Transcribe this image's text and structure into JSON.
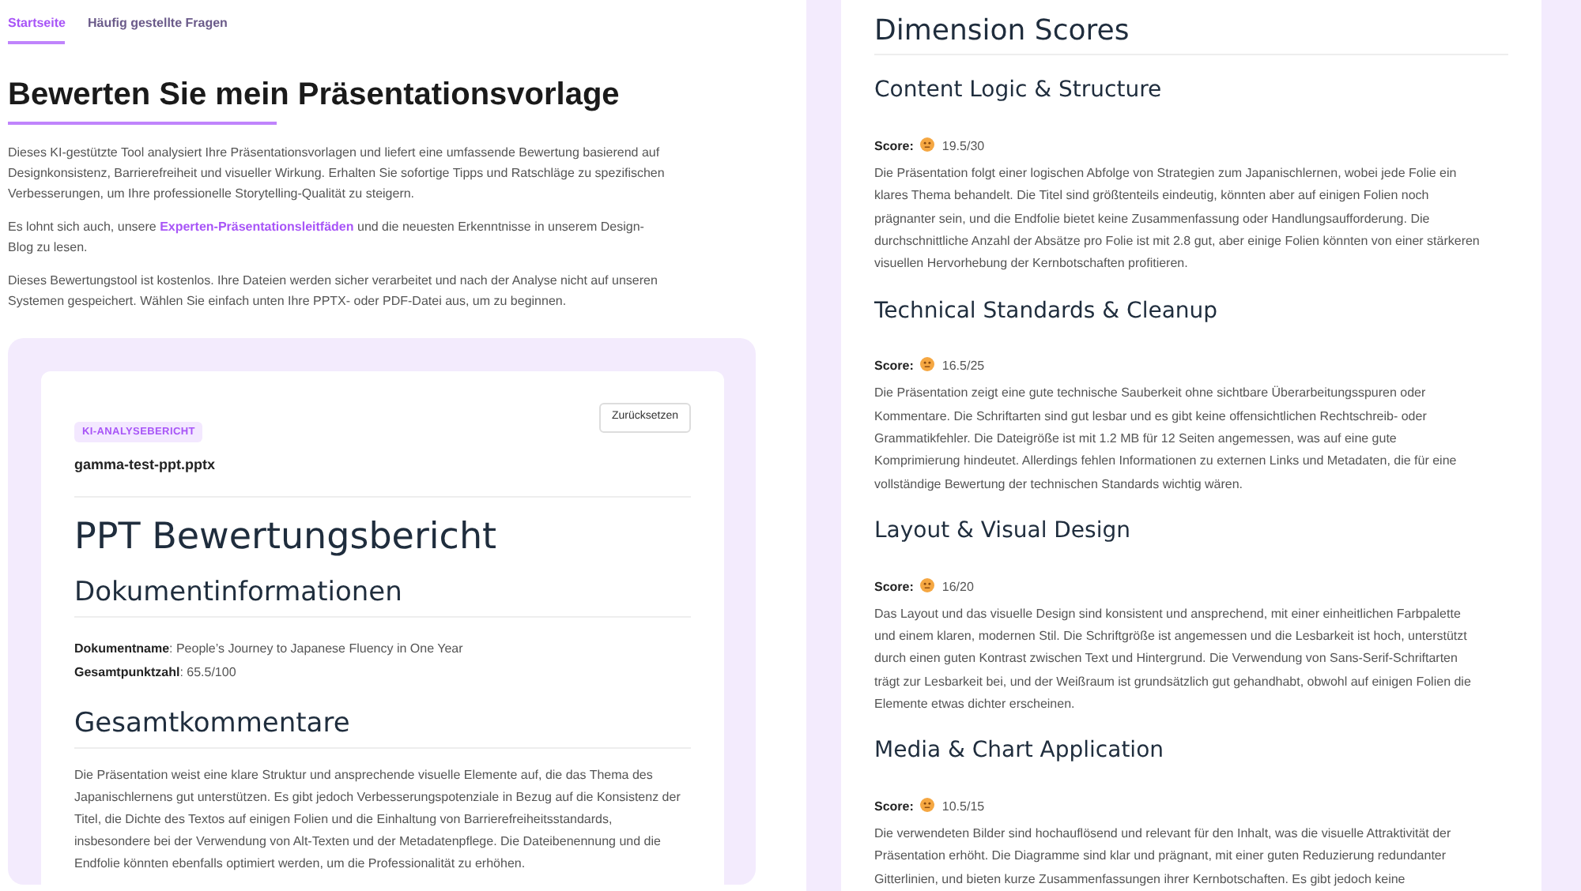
{
  "nav": {
    "tabs": [
      {
        "label": "Startseite",
        "selected": true
      },
      {
        "label": "Häufig gestellte Fragen",
        "selected": false
      }
    ]
  },
  "intro": {
    "title": "Bewerten Sie mein Präsentationsvorlage",
    "paragraphs": [
      {
        "text": "Dieses KI-gestützte Tool analysiert Ihre Präsentationsvorlagen und liefert eine umfassende Bewertung basierend auf Designkonsistenz, Barrierefreiheit und visueller Wirkung. Erhalten Sie sofortige Tipps und Ratschläge zu spezifischen Verbesserungen, um Ihre professionelle Storytelling-Qualität zu steigern."
      },
      {
        "text": "Es lohnt sich auch, unsere ",
        "link": "Experten-Präsentationsleitfäden",
        "after": " und die neuesten Erkenntnisse in unserem Design-Blog zu lesen."
      },
      {
        "text": "Dieses Bewertungstool ist kostenlos. Ihre Dateien werden sicher verarbeitet und nach der Analyse nicht auf unseren Systemen gespeichert. Wählen Sie einfach unten Ihre PPTX- oder PDF-Datei aus, um zu beginnen."
      }
    ]
  },
  "report": {
    "badge": "KI-ANALYSEBERICHT",
    "reset_button": "Zurücksetzen",
    "filename": "gamma-test-ppt.pptx",
    "title": "PPT Bewertungsbericht",
    "doc_info": {
      "heading": "Dokumentinformationen",
      "fields": [
        "**Dokumentname**: People’s Journey to Japanese Fluency in One Year",
        "**Gesamtpunktzahl**: 65.5/100"
      ]
    },
    "comments": {
      "heading": "Gesamtkommentare",
      "text": "Die Präsentation weist eine klare Struktur und ansprechende visuelle Elemente auf, die das Thema des Japanischlernens gut unterstützen. Es gibt jedoch Verbesserungspotenziale in Bezug auf die Konsistenz der Titel, die Dichte des Textos auf einigen Folien und die Einhaltung von Barrierefreiheitsstandards, insbesondere bei der Verwendung von Alt-Texten und der Metadatenpflege. Die Dateibenennung und die Endfolie könnten ebenfalls optimiert werden, um die Professionalität zu erhöhen."
    }
  },
  "dimensions": {
    "title": "Dimension Scores",
    "items": [
      {
        "title": "Content Logic & Structure",
        "score_label": "Score:",
        "score": "19.5/30",
        "text": "Die Präsentation folgt einer logischen Abfolge von Strategien zum Japanischlernen, wobei jede Folie ein klares Thema behandelt. Die Titel sind größtenteils eindeutig, könnten aber auf einigen Folien noch prägnanter sein, und die Endfolie bietet keine Zusammenfassung oder Handlungsaufforderung. Die durchschnittliche Anzahl der Absätze pro Folie ist mit 2.8 gut, aber einige Folien könnten von einer stärkeren visuellen Hervorhebung der Kernbotschaften profitieren."
      },
      {
        "title": "Technical Standards & Cleanup",
        "score_label": "Score:",
        "score": "16.5/25",
        "text": "Die Präsentation zeigt eine gute technische Sauberkeit ohne sichtbare Überarbeitungsspuren oder Kommentare. Die Schriftarten sind gut lesbar und es gibt keine offensichtlichen Rechtschreib- oder Grammatikfehler. Die Dateigröße ist mit 1.2 MB für 12 Seiten angemessen, was auf eine gute Komprimierung hindeutet. Allerdings fehlen Informationen zu externen Links und Metadaten, die für eine vollständige Bewertung der technischen Standards wichtig wären."
      },
      {
        "title": "Layout & Visual Design",
        "score_label": "Score:",
        "score": "16/20",
        "text": "Das Layout und das visuelle Design sind konsistent und ansprechend, mit einer einheitlichen Farbpalette und einem klaren, modernen Stil. Die Schriftgröße ist angemessen und die Lesbarkeit ist hoch, unterstützt durch einen guten Kontrast zwischen Text und Hintergrund. Die Verwendung von Sans-Serif-Schriftarten trägt zur Lesbarkeit bei, und der Weißraum ist grundsätzlich gut gehandhabt, obwohl auf einigen Folien die Elemente etwas dichter erscheinen."
      },
      {
        "title": "Media & Chart Application",
        "score_label": "Score:",
        "score": "10.5/15",
        "text": "Die verwendeten Bilder sind hochauflösend und relevant für den Inhalt, was die visuelle Attraktivität der Präsentation erhöht. Die Diagramme sind klar und prägnant, mit einer guten Reduzierung redundanter Gitterlinien, und bieten kurze Zusammenfassungen ihrer Kernbotschaften. Es gibt jedoch keine"
      }
    ]
  }
}
